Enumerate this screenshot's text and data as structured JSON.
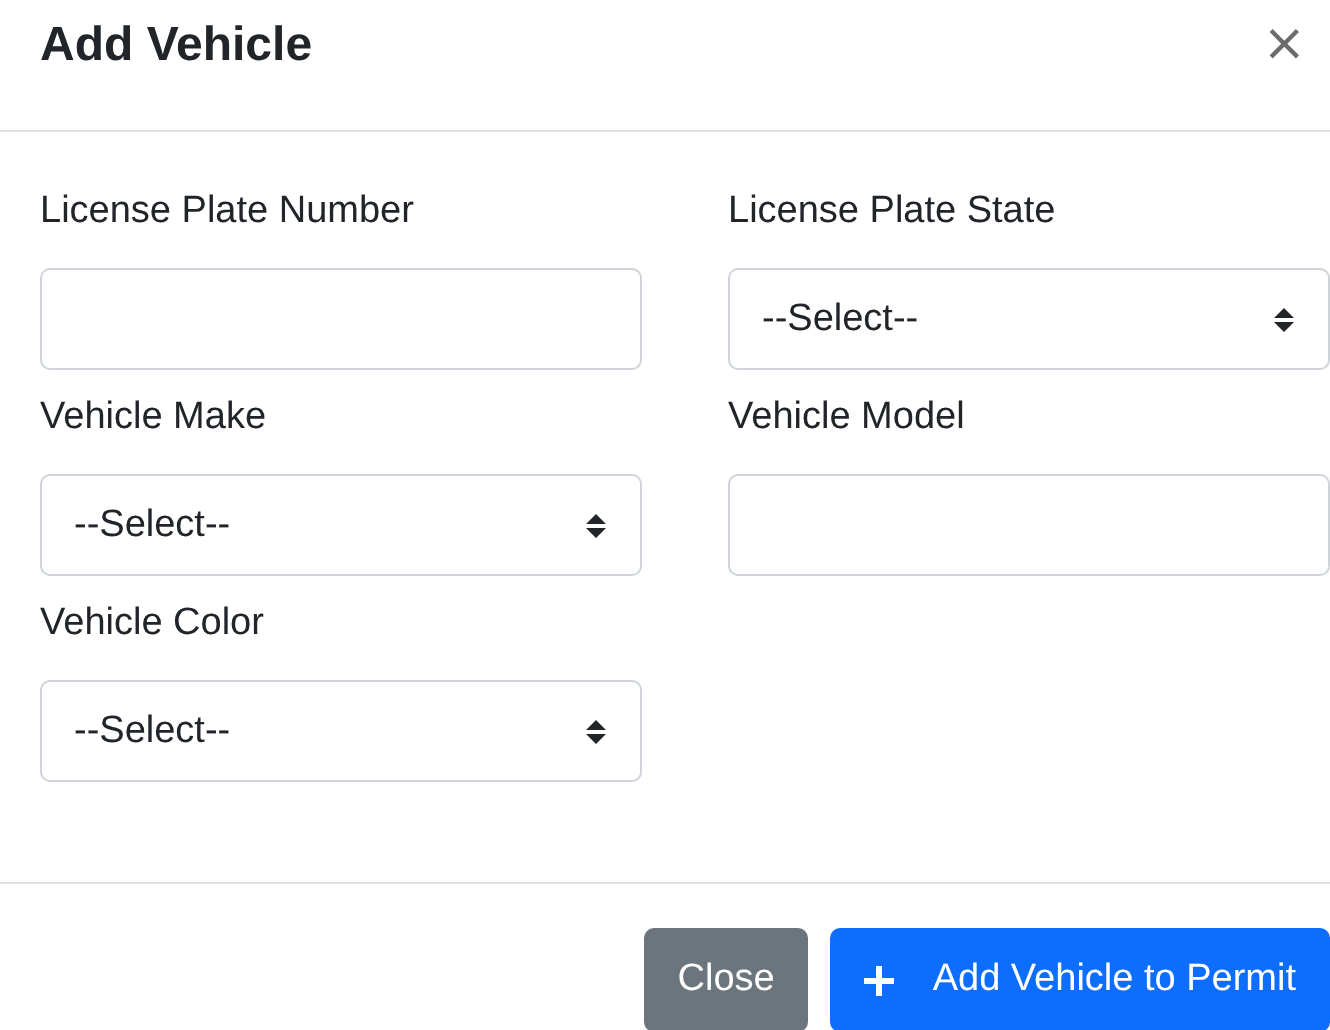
{
  "dialog": {
    "title": "Add Vehicle",
    "close": "×"
  },
  "fields": [
    {
      "label": "License Plate Number",
      "kind": "text"
    },
    {
      "label": "License Plate State",
      "kind": "select",
      "value": "--Select--"
    },
    {
      "label": "Vehicle Make",
      "kind": "select",
      "value": "--Select--"
    },
    {
      "label": "Vehicle Model",
      "kind": "text"
    },
    {
      "label": "Vehicle Color",
      "kind": "select",
      "value": "--Select--"
    }
  ],
  "buttons": [
    {
      "label": "Close",
      "kind": "secondary"
    },
    {
      "label": "Add Vehicle to Permit",
      "kind": "primary"
    }
  ]
}
